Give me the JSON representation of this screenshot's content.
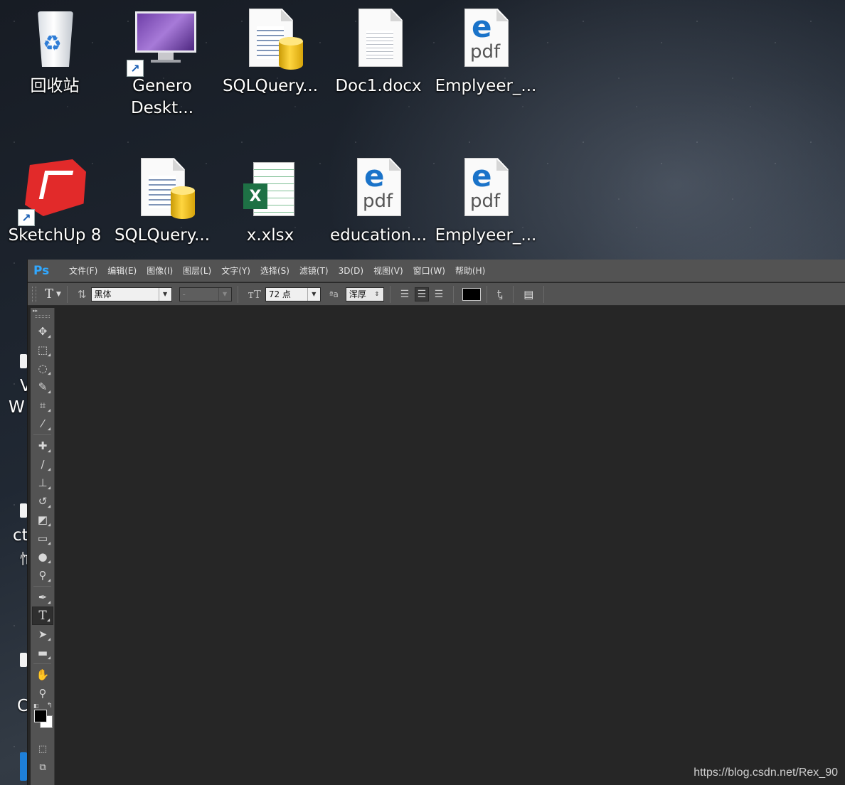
{
  "desktop": {
    "icons": [
      {
        "label": "回收站",
        "icon": "recycle-bin-icon"
      },
      {
        "label": "Genero\nDeskt...",
        "icon": "monitor-shortcut-icon"
      },
      {
        "label": "SQLQuery...",
        "icon": "sql-query-file-icon"
      },
      {
        "label": "Doc1.docx",
        "icon": "word-document-icon"
      },
      {
        "label": "Emplyeer_...",
        "icon": "pdf-edge-icon"
      },
      {
        "label": "SketchUp 8",
        "icon": "sketchup-shortcut-icon"
      },
      {
        "label": "SQLQuery...",
        "icon": "sql-query-file-icon"
      },
      {
        "label": "x.xlsx",
        "icon": "excel-file-icon"
      },
      {
        "label": "education...",
        "icon": "pdf-edge-icon"
      },
      {
        "label": "Emplyeer_...",
        "icon": "pdf-edge-icon"
      }
    ],
    "edge_fragments": [
      "V",
      "W",
      "ct",
      "忙",
      "C"
    ]
  },
  "photoshop": {
    "logo": "Ps",
    "menu": [
      "文件(F)",
      "编辑(E)",
      "图像(I)",
      "图层(L)",
      "文字(Y)",
      "选择(S)",
      "滤镜(T)",
      "3D(D)",
      "视图(V)",
      "窗口(W)",
      "帮助(H)"
    ],
    "options": {
      "tool_glyph": "T",
      "font_family": "黑体",
      "font_style": "-",
      "font_size": "72 点",
      "aa_label": "ªa",
      "antialias": "浑厚",
      "text_color": "#000000"
    },
    "tools": [
      "move-tool-icon",
      "marquee-tool-icon",
      "lasso-tool-icon",
      "quick-select-tool-icon",
      "crop-tool-icon",
      "eyedropper-tool-icon",
      "healing-brush-tool-icon",
      "brush-tool-icon",
      "clone-stamp-tool-icon",
      "history-brush-tool-icon",
      "eraser-tool-icon",
      "gradient-tool-icon",
      "blur-tool-icon",
      "dodge-tool-icon",
      "pen-tool-icon",
      "type-tool-icon",
      "path-select-tool-icon",
      "rectangle-tool-icon",
      "hand-tool-icon",
      "zoom-tool-icon"
    ],
    "active_tool": "type-tool-icon",
    "foreground_color": "#000000",
    "background_color": "#ffffff"
  },
  "watermark": "https://blog.csdn.net/Rex_90"
}
